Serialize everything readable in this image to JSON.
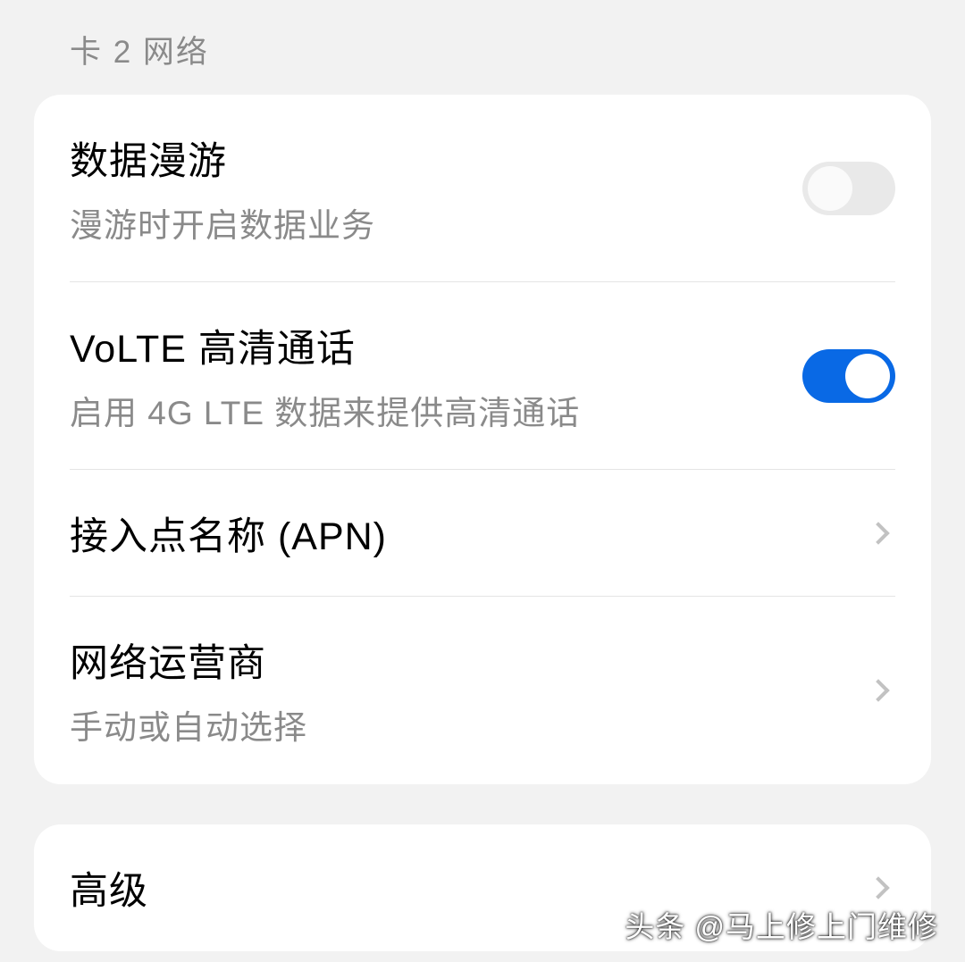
{
  "section_header": "卡 2 网络",
  "group1": {
    "roaming": {
      "title": "数据漫游",
      "sub": "漫游时开启数据业务",
      "enabled": false
    },
    "volte": {
      "title": "VoLTE 高清通话",
      "sub": "启用 4G LTE 数据来提供高清通话",
      "enabled": true
    },
    "apn": {
      "title": "接入点名称 (APN)"
    },
    "carrier": {
      "title": "网络运营商",
      "sub": "手动或自动选择"
    }
  },
  "group2": {
    "advanced": {
      "title": "高级"
    }
  },
  "watermark": "头条 @马上修上门维修"
}
